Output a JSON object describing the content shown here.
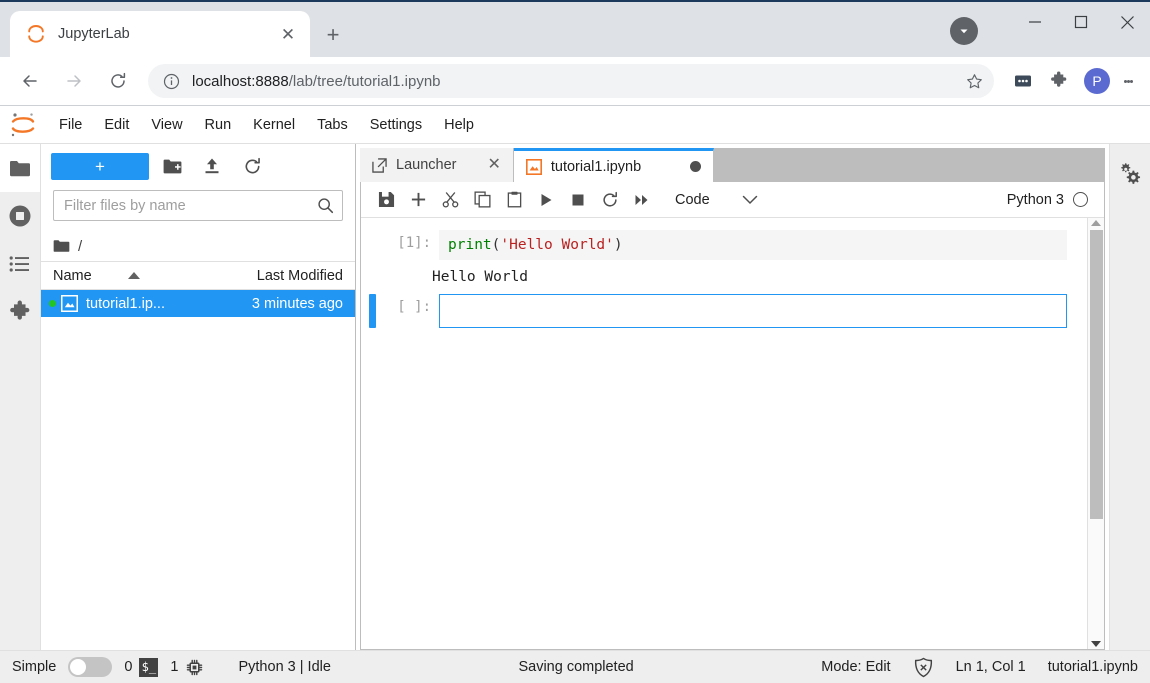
{
  "browser": {
    "tab": {
      "title": "JupyterLab",
      "favicon": "jupyter-logo-icon",
      "close": "✕"
    },
    "new_tab": "+",
    "window_controls": {
      "minimize": "—",
      "maximize": "□",
      "close": "✕"
    },
    "nav": {
      "back": "←",
      "forward": "→",
      "reload": "⟳"
    },
    "omnibox": {
      "info_icon": "info-circle-icon",
      "url_host": "localhost:8888",
      "url_path": "/lab/tree/tutorial1.ipynb",
      "star_icon": "bookmark-star-icon"
    },
    "extensions": {
      "dots": "extension-dots-icon",
      "puzzle": "extensions-puzzle-icon"
    },
    "profile_initial": "P",
    "menu_icon": "kebab-menu-icon"
  },
  "jupyter": {
    "logo": "jupyter-logo-icon",
    "menubar": [
      "File",
      "Edit",
      "View",
      "Run",
      "Kernel",
      "Tabs",
      "Settings",
      "Help"
    ],
    "activitybar": [
      {
        "name": "file-browser",
        "icon": "folder-icon",
        "active": true
      },
      {
        "name": "running-terminals-kernels",
        "icon": "stop-circle-icon",
        "active": false
      },
      {
        "name": "commands",
        "icon": "list-icon",
        "active": false
      },
      {
        "name": "extension-manager",
        "icon": "puzzle-icon",
        "active": false
      }
    ],
    "rightbar": [
      {
        "name": "property-inspector",
        "icon": "double-gear-icon"
      }
    ],
    "filebrowser": {
      "new_launcher_label": "+",
      "toolbar_icons": [
        "new-folder-icon",
        "upload-icon",
        "refresh-icon"
      ],
      "filter_placeholder": "Filter files by name",
      "filter_value": "",
      "search_icon": "search-icon",
      "breadcrumb_icon": "folder-icon",
      "breadcrumb_path": "/",
      "columns": {
        "name": "Name",
        "last_modified": "Last Modified"
      },
      "sort_icon": "sort-ascending-caret-icon",
      "rows": [
        {
          "name": "tutorial1.ip...",
          "last_modified": "3 minutes ago",
          "icon": "notebook-icon",
          "running": true,
          "selected": true
        }
      ]
    },
    "dock": {
      "tabs": [
        {
          "label": "Launcher",
          "icon": "launcher-icon",
          "current": false,
          "close": "✕"
        },
        {
          "label": "tutorial1.ipynb",
          "icon": "notebook-icon",
          "current": true,
          "dirty_dot": true
        }
      ]
    },
    "notebook": {
      "toolbar_icons": [
        "save-icon",
        "insert-cell-icon",
        "cut-icon",
        "copy-icon",
        "paste-icon",
        "run-icon",
        "stop-icon",
        "restart-icon",
        "restart-run-all-icon"
      ],
      "cell_type": "Code",
      "cell_type_caret": "chevron-down-icon",
      "kernel_name": "Python 3",
      "kernel_status_icon": "idle-circle-icon",
      "cells": [
        {
          "prompt": "[1]:",
          "active": false,
          "code": {
            "fn": "print",
            "open": "(",
            "str": "'Hello World'",
            "close": ")"
          },
          "output": "Hello World"
        },
        {
          "prompt": "[ ]:",
          "active": true,
          "code": null,
          "output": null
        }
      ],
      "scrollbar": {
        "up": "scroll-up-arrow",
        "down": "scroll-down-arrow"
      }
    },
    "statusbar": {
      "simple_label": "Simple",
      "simple_toggle_on": false,
      "terminals_count": "0",
      "terminal_icon": "terminal-icon",
      "kernels_count": "1",
      "kernel_icon": "kernel-chip-icon",
      "kernel_status": "Python 3 | Idle",
      "message": "Saving completed",
      "mode": "Mode: Edit",
      "trust_icon": "shield-x-icon",
      "cursor_position": "Ln 1, Col 1",
      "filename": "tutorial1.ipynb"
    }
  },
  "colors": {
    "accent_blue": "#2196f3",
    "jupyter_orange": "#f37726",
    "chrome_tabstrip": "#dee1e6",
    "panel_gray": "#eeeeee",
    "string_red": "#ba2121",
    "keyword_green": "#008000",
    "running_green": "#22c522"
  }
}
